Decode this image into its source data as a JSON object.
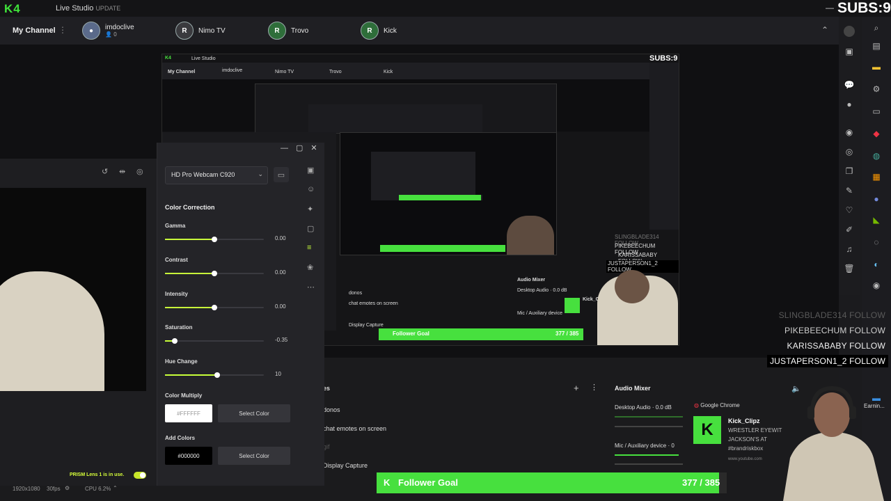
{
  "app": {
    "logo": "K4",
    "title": "Live Studio",
    "title_badge": "UPDATE",
    "subs_overlay": "SUBS:9"
  },
  "channels": {
    "my_channel": "My Channel",
    "items": [
      {
        "name": "imdoclive",
        "sub": "0",
        "initial": ""
      },
      {
        "name": "Nimo TV",
        "initial": "R"
      },
      {
        "name": "Trovo",
        "initial": "R"
      },
      {
        "name": "Kick",
        "initial": "R"
      }
    ]
  },
  "lens": {
    "camera": "HD Pro Webcam C920",
    "section_title": "Color Correction",
    "sliders": [
      {
        "label": "Gamma",
        "value": "0.00",
        "fraction": 0.5
      },
      {
        "label": "Contrast",
        "value": "0.00",
        "fraction": 0.5
      },
      {
        "label": "Intensity",
        "value": "0.00",
        "fraction": 0.5
      },
      {
        "label": "Saturation",
        "value": "-0.35",
        "fraction": 0.1
      },
      {
        "label": "Hue Change",
        "value": "10",
        "fraction": 0.53
      }
    ],
    "color_multiply": {
      "label": "Color Multiply",
      "value": "#FFFFFF",
      "button": "Select Color"
    },
    "add_colors": {
      "label": "Add Colors",
      "value": "#000000",
      "button": "Select Color"
    },
    "in_use_note": "PRISM Lens 1 is in use."
  },
  "statusbar": {
    "resolution": "1920x1080",
    "fps": "30fps",
    "cpu": "CPU 6.2%"
  },
  "sources": {
    "header_partial": "es",
    "items": [
      "donos",
      "chat emotes on screen",
      "gif",
      "Display Capture"
    ]
  },
  "mixer": {
    "title": "Audio Mixer",
    "desktop": "Desktop Audio",
    "desktop_db": "0.0 dB",
    "mic": "Mic / Auxiliary device",
    "mic_db": "0"
  },
  "chrome_widget": {
    "title": "Google Chrome",
    "channel": "Kick_Clipz",
    "line1": "WRESTLER EYEWIT",
    "line2": "JACKSON'S AT",
    "line3": "#brandriskbox",
    "url": "www.youtube.com"
  },
  "followers": {
    "list": [
      "SLINGBLADE314",
      "PIKEBEECHUM",
      "KARISSABABY",
      "JUSTAPERSON1_2"
    ],
    "action": "FOLLOW"
  },
  "follower_goal": {
    "label": "Follower Goal",
    "count": "377 / 385",
    "progress": 0.979
  },
  "right_bar": {
    "earnings_label": "Earnin..."
  },
  "colors": {
    "accent": "#47e03e",
    "slider_fill": "#c8ff3a",
    "bg": "#1b1b1e"
  }
}
